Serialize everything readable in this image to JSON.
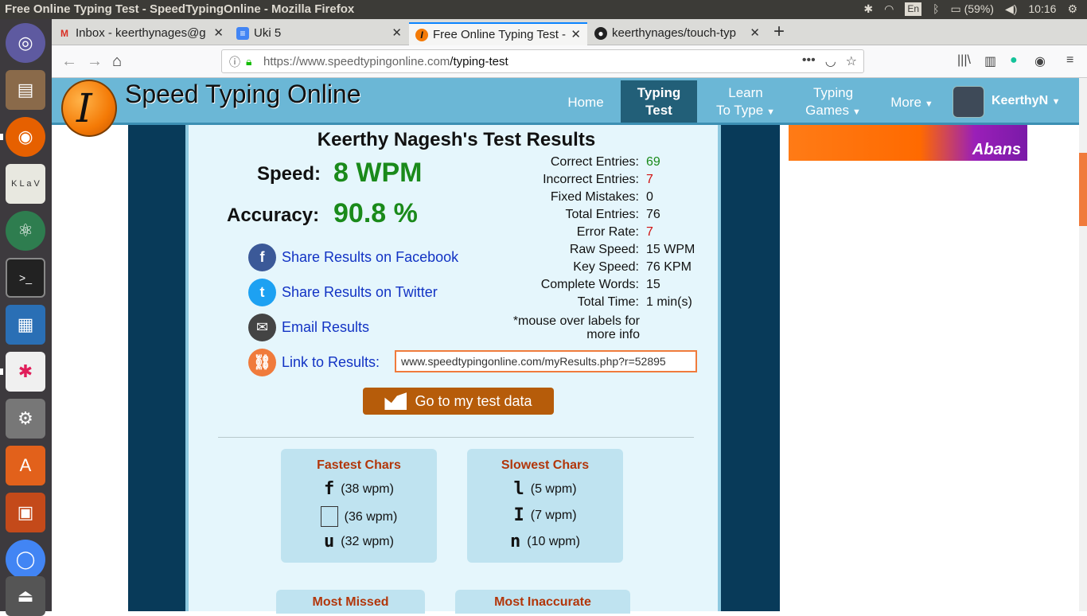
{
  "os": {
    "window_title": "Free Online Typing Test - SpeedTypingOnline - Mozilla Firefox",
    "lang": "En",
    "battery": "(59%)",
    "clock": "10:16"
  },
  "browser": {
    "tabs": [
      {
        "label": "Inbox - keerthynages@g",
        "icon": "gmail-icon"
      },
      {
        "label": "Uki 5",
        "icon": "docs-icon"
      },
      {
        "label": "Free Online Typing Test -",
        "icon": "sto-icon"
      },
      {
        "label": "keerthynages/touch-typ",
        "icon": "github-icon"
      }
    ],
    "url_host": "https://www.speedtypingonline.com",
    "url_path": "/typing-test"
  },
  "site": {
    "name": "Speed Typing Online",
    "logo_letter": "I",
    "nav": [
      {
        "line1": "Home",
        "line2": ""
      },
      {
        "line1": "Typing",
        "line2": "Test"
      },
      {
        "line1": "Learn",
        "line2": "To Type"
      },
      {
        "line1": "Typing",
        "line2": "Games"
      },
      {
        "line1": "More",
        "line2": ""
      }
    ],
    "user": "KeerthyN",
    "ad_text": "Abans"
  },
  "results": {
    "title": "Keerthy Nagesh's Test Results",
    "speed_label": "Speed:",
    "speed_value": "8 WPM",
    "accuracy_label": "Accuracy:",
    "accuracy_value": "90.8 %",
    "share_facebook": "Share Results on Facebook",
    "share_twitter": "Share Results on Twitter",
    "email": "Email Results",
    "link_label": "Link to Results:",
    "link_value": "www.speedtypingonline.com/myResults.php?r=52895",
    "stats": [
      {
        "label": "Correct Entries:",
        "value": "69",
        "color": "#1a8a1a"
      },
      {
        "label": "Incorrect Entries:",
        "value": "7",
        "color": "#d01010"
      },
      {
        "label": "Fixed Mistakes:",
        "value": "0",
        "color": "#111111"
      },
      {
        "label": "Total Entries:",
        "value": "76",
        "color": "#111111"
      },
      {
        "label": "Error Rate:",
        "value": "7",
        "color": "#d01010"
      },
      {
        "label": "Raw Speed:",
        "value": "15 WPM",
        "color": "#111111"
      },
      {
        "label": "Key Speed:",
        "value": "76 KPM",
        "color": "#111111"
      },
      {
        "label": "Complete Words:",
        "value": "15",
        "color": "#111111"
      },
      {
        "label": "Total Time:",
        "value": "1 min(s)",
        "color": "#111111"
      }
    ],
    "note_line1": "*mouse over labels for",
    "note_line2": "more info",
    "go_button": "Go to my test data",
    "fastest_title": "Fastest Chars",
    "fastest": [
      {
        "char": "f",
        "wpm": "(38 wpm)"
      },
      {
        "char": "",
        "wpm": "(36 wpm)"
      },
      {
        "char": "u",
        "wpm": "(32 wpm)"
      }
    ],
    "slowest_title": "Slowest Chars",
    "slowest": [
      {
        "char": "l",
        "wpm": "(5 wpm)"
      },
      {
        "char": "I",
        "wpm": "(7 wpm)"
      },
      {
        "char": "n",
        "wpm": "(10 wpm)"
      }
    ],
    "most_missed": "Most Missed",
    "most_inaccurate": "Most Inaccurate"
  }
}
